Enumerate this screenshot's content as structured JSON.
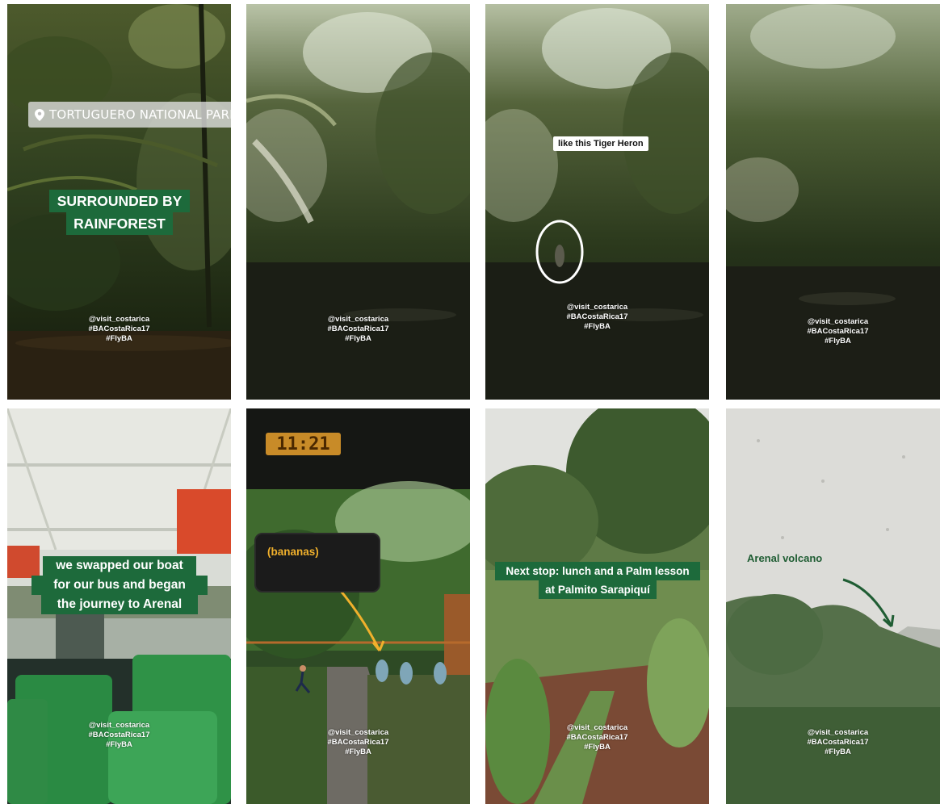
{
  "grid": {
    "panels": [
      {
        "id": "p1",
        "location_sticker": "TORTUGUERO NATIONAL PARK",
        "caption": [
          "SURROUNDED BY",
          "RAINFOREST"
        ],
        "tags": [
          "@visit_costarica",
          "#BACostaRica17",
          "#FlyBA"
        ]
      },
      {
        "id": "p2",
        "tags": [
          "@visit_costarica",
          "#BACostaRica17",
          "#FlyBA"
        ]
      },
      {
        "id": "p3",
        "caption": "like this Tiger Heron",
        "tags": [
          "@visit_costarica",
          "#BACostaRica17",
          "#FlyBA"
        ]
      },
      {
        "id": "p4",
        "tags": [
          "@visit_costarica",
          "#BACostaRica17",
          "#FlyBA"
        ]
      },
      {
        "id": "p5",
        "caption": [
          "we swapped our boat",
          "for our bus and began",
          "the journey to Arenal"
        ],
        "tags": [
          "@visit_costarica",
          "#BACostaRica17",
          "#FlyBA"
        ]
      },
      {
        "id": "p6",
        "clock": "11:21",
        "caption": "(bananas)",
        "tags": [
          "@visit_costarica",
          "#BACostaRica17",
          "#FlyBA"
        ]
      },
      {
        "id": "p7",
        "caption": [
          "Next stop: lunch and a Palm lesson",
          "at Palmito Sarapiquí"
        ],
        "tags": [
          "@visit_costarica",
          "#BACostaRica17",
          "#FlyBA"
        ]
      },
      {
        "id": "p8",
        "caption": "Arenal volcano",
        "tags": [
          "@visit_costarica",
          "#BACostaRica17",
          "#FlyBA"
        ]
      }
    ]
  },
  "colors": {
    "caption_green": "#1d6a3b",
    "bananas_yellow": "#f0b02c",
    "arrow_green": "#1f5d33"
  },
  "icons": {
    "location": "map-pin-icon",
    "circle": "circle-highlight-icon",
    "arrow": "curved-arrow-icon"
  }
}
